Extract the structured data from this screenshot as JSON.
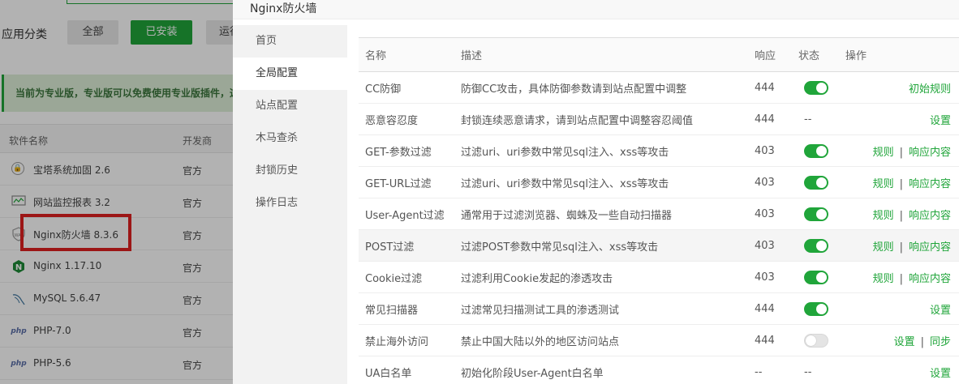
{
  "background": {
    "category_label": "应用分类",
    "categories": [
      "全部",
      "已安装",
      "运行"
    ],
    "notice": "当前为专业版，专业版可以免费使用专业版插件，这",
    "columns": [
      "软件名称",
      "开发商"
    ],
    "software": [
      {
        "icon": "shield-icon",
        "name": "宝塔系统加固 2.6",
        "dev": "官方"
      },
      {
        "icon": "monitor-chart-icon",
        "name": "网站监控报表 3.2",
        "dev": "官方"
      },
      {
        "icon": "waf-shield-icon",
        "name": "Nginx防火墙 8.3.6",
        "dev": "官方"
      },
      {
        "icon": "nginx-icon",
        "name": "Nginx 1.17.10",
        "dev": "官方"
      },
      {
        "icon": "mysql-icon",
        "name": "MySQL 5.6.47",
        "dev": "官方"
      },
      {
        "icon": "php-icon",
        "name": "PHP-7.0",
        "dev": "官方"
      },
      {
        "icon": "php-icon",
        "name": "PHP-5.6",
        "dev": "官方"
      }
    ]
  },
  "dialog": {
    "title": "Nginx防火墙",
    "sidebar": [
      "首页",
      "全局配置",
      "站点配置",
      "木马查杀",
      "封锁历史",
      "操作日志"
    ],
    "active_tab": "全局配置",
    "columns": {
      "name": "名称",
      "desc": "描述",
      "resp": "响应",
      "status": "状态",
      "ops": "操作"
    },
    "rows": [
      {
        "name": "CC防御",
        "desc": "防御CC攻击，具体防御参数请到站点配置中调整",
        "resp": "444",
        "status": "on",
        "ops": [
          "初始规则"
        ]
      },
      {
        "name": "恶意容忍度",
        "desc": "封锁连续恶意请求，请到站点配置中调整容忍阈值",
        "resp": "444",
        "status": "--",
        "ops": [
          "设置"
        ]
      },
      {
        "name": "GET-参数过滤",
        "desc": "过滤uri、uri参数中常见sql注入、xss等攻击",
        "resp": "403",
        "status": "on",
        "ops": [
          "规则",
          "响应内容"
        ]
      },
      {
        "name": "GET-URL过滤",
        "desc": "过滤uri、uri参数中常见sql注入、xss等攻击",
        "resp": "403",
        "status": "on",
        "ops": [
          "规则",
          "响应内容"
        ]
      },
      {
        "name": "User-Agent过滤",
        "desc": "通常用于过滤浏览器、蜘蛛及一些自动扫描器",
        "resp": "403",
        "status": "on",
        "ops": [
          "规则",
          "响应内容"
        ]
      },
      {
        "name": "POST过滤",
        "desc": "过滤POST参数中常见sql注入、xss等攻击",
        "resp": "403",
        "status": "on",
        "ops": [
          "规则",
          "响应内容"
        ]
      },
      {
        "name": "Cookie过滤",
        "desc": "过滤利用Cookie发起的渗透攻击",
        "resp": "403",
        "status": "on",
        "ops": [
          "规则",
          "响应内容"
        ]
      },
      {
        "name": "常见扫描器",
        "desc": "过滤常见扫描测试工具的渗透测试",
        "resp": "444",
        "status": "on",
        "ops": [
          "设置"
        ]
      },
      {
        "name": "禁止海外访问",
        "desc": "禁止中国大陆以外的地区访问站点",
        "resp": "444",
        "status": "off",
        "ops": [
          "设置",
          "同步"
        ]
      },
      {
        "name": "UA白名单",
        "desc": "初始化阶段User-Agent白名单",
        "resp": "--",
        "status": "--",
        "ops": [
          "设置"
        ]
      }
    ],
    "separator": "|"
  }
}
